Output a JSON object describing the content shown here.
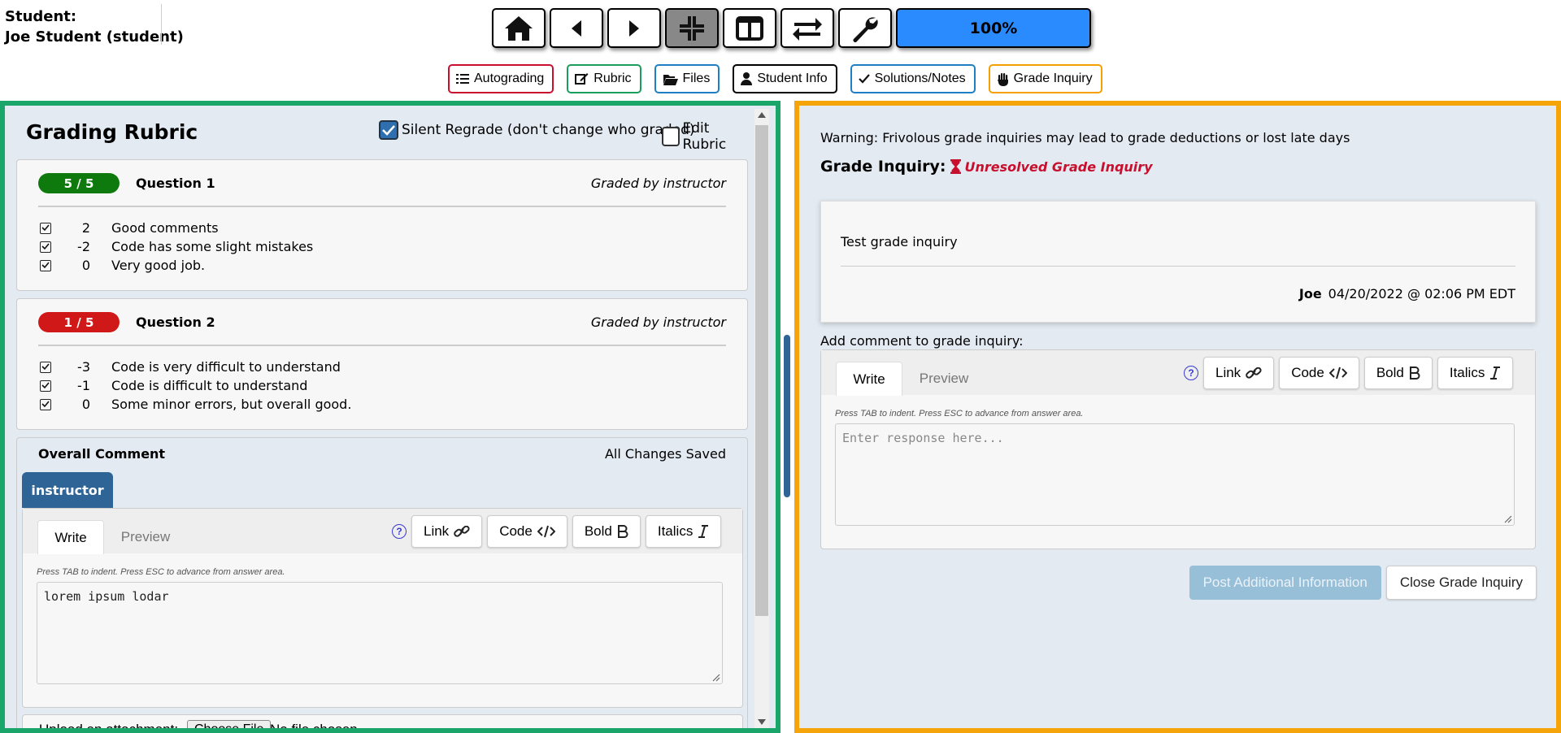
{
  "student": {
    "label": "Student:",
    "name": "Joe Student (student)"
  },
  "nav": {
    "progress": "100%",
    "icons": [
      "home-icon",
      "prev-icon",
      "next-icon",
      "collapse-icon",
      "two-panel-icon",
      "swap-icon",
      "wrench-icon"
    ]
  },
  "panel_tabs": {
    "autograding": "Autograding",
    "rubric": "Rubric",
    "files": "Files",
    "student_info": "Student Info",
    "solutions": "Solutions/Notes",
    "grade_inquiry": "Grade Inquiry"
  },
  "rubric": {
    "title": "Grading Rubric",
    "silent_regrade": "Silent Regrade (don't change who graded)",
    "edit_rubric": "Edit Rubric",
    "questions": [
      {
        "score": "5 / 5",
        "title": "Question 1",
        "graded_by": "Graded by instructor",
        "marks": [
          {
            "points": "2",
            "desc": "Good comments"
          },
          {
            "points": "-2",
            "desc": "Code has some slight mistakes"
          },
          {
            "points": "0",
            "desc": "Very good job."
          }
        ]
      },
      {
        "score": "1 / 5",
        "title": "Question 2",
        "graded_by": "Graded by instructor",
        "marks": [
          {
            "points": "-3",
            "desc": "Code is very difficult to understand"
          },
          {
            "points": "-1",
            "desc": "Code is difficult to understand"
          },
          {
            "points": "0",
            "desc": "Some minor errors, but overall good."
          }
        ]
      }
    ],
    "overall": {
      "title": "Overall Comment",
      "saved": "All Changes Saved",
      "tab": "instructor",
      "editor": {
        "write": "Write",
        "preview": "Preview",
        "help": "?",
        "link": "Link",
        "code": "Code",
        "bold": "Bold",
        "italics": "Italics",
        "hint": "Press TAB to indent. Press ESC to advance from answer area.",
        "value": "lorem ipsum lodar"
      },
      "upload_label": "Upload an attachment:",
      "choose_file": "Choose File",
      "no_file": "No file chosen"
    }
  },
  "grade_inquiry": {
    "warning": "Warning: Frivolous grade inquiries may lead to grade deductions or lost late days",
    "heading": "Grade Inquiry:",
    "status": "Unresolved Grade Inquiry",
    "post": {
      "text": "Test grade inquiry",
      "author": "Joe",
      "timestamp": "04/20/2022 @ 02:06 PM EDT"
    },
    "add_comment_label": "Add comment to grade inquiry:",
    "editor": {
      "write": "Write",
      "preview": "Preview",
      "help": "?",
      "link": "Link",
      "code": "Code",
      "bold": "Bold",
      "italics": "Italics",
      "hint": "Press TAB to indent. Press ESC to advance from answer area.",
      "placeholder": "Enter response here..."
    },
    "post_button": "Post Additional Information",
    "close_button": "Close Grade Inquiry"
  },
  "colors": {
    "rubric_border": "#1aa66a",
    "inquiry_border": "#f5a50a",
    "progress": "#2a8bff",
    "pass": "#0e7a0e",
    "fail": "#d01818",
    "accent": "#2f6596"
  }
}
